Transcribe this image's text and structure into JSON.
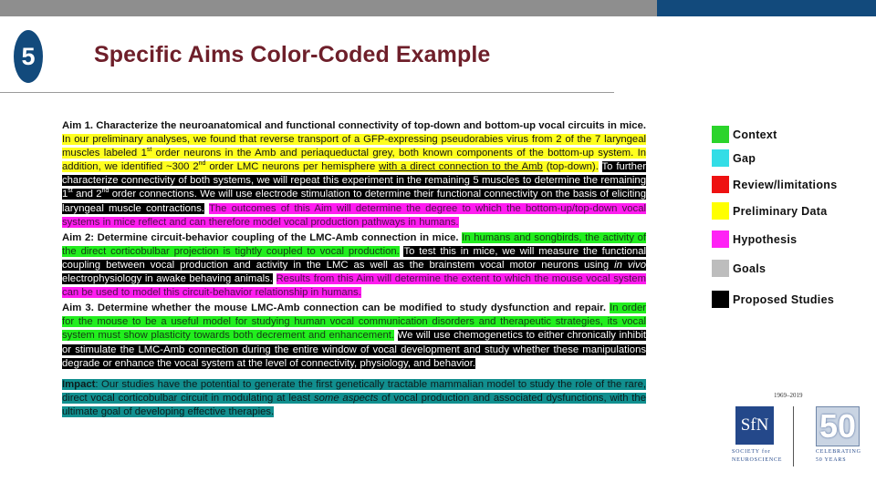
{
  "header": {
    "slide_number": "5",
    "title": "Specific Aims Color-Coded Example"
  },
  "document": {
    "aim1": {
      "heading": "Aim 1. Characterize the neuroanatomical and functional connectivity of top-down and bottom-up vocal circuits in mice.",
      "preliminary_a": "In our preliminary analyses, we found that reverse transport of a GFP-expressing pseudorabies virus from 2 of the 7 laryngeal muscles labeled 1",
      "sup1": "st",
      "preliminary_b": " order neurons in the Amb and periaqueductal grey, both known components of the bottom-up system. In addition, we identified ~300 2",
      "sup2": "nd",
      "preliminary_c": " order LMC neurons per hemisphere ",
      "preliminary_underlined": "with a direct connection to the Amb",
      "preliminary_d": " (top-down).",
      "proposed_a": "To further characterize connectivity of both systems, we will repeat this experiment in the remaining 5 muscles to determine the remaining 1",
      "sup3": "st",
      "proposed_b": " and 2",
      "sup4": "nd",
      "proposed_c": " order connections. We will use electrode stimulation to determine their functional connectivity on the basis of eliciting laryngeal muscle contractions.",
      "hypothesis": "The outcomes of this Aim will determine the degree to which the bottom-up/top-down vocal systems in mice reflect and can therefore model vocal production pathways in humans."
    },
    "aim2": {
      "heading": "Aim 2: Determine circuit-behavior coupling of the LMC-Amb connection in mice.",
      "context": "In humans and songbirds, the activity of the direct corticobulbar projection is tightly coupled to vocal production.",
      "proposed_a": "To test this in mice, we will measure the functional coupling between vocal production and activity in the LMC as well as the brainstem vocal motor neurons using ",
      "proposed_italic": "in vivo",
      "proposed_b": " electrophysiology in awake behaving animals.",
      "hypothesis": "Results from this Aim will determine the extent to which the mouse vocal system can be used to model this circuit-behavior relationship in humans."
    },
    "aim3": {
      "heading": "Aim 3. Determine whether the mouse LMC-Amb connection can be modified to study dysfunction and repair.",
      "context": "In order for the mouse to be a useful model for studying human vocal communication disorders and therapeutic strategies, its vocal system must show plasticity towards both decrement and enhancement.",
      "proposed": "We will use chemogenetics to either chronically inhibit or stimulate the LMC-Amb connection during the entire window of vocal development and study whether these manipulations degrade or enhance the vocal system at the level of connectivity, physiology, and behavior."
    },
    "impact": {
      "label": "Impact",
      "text_a": ": Our studies have the potential to generate the first genetically tractable mammalian model to study the role of the rare, direct vocal corticobulbar circuit in modulating at least ",
      "text_italic": "some aspects",
      "text_b": " of vocal production and associated dysfunctions, with the ultimate goal of developing effective therapies."
    }
  },
  "legend": [
    {
      "label": "Context",
      "color": "#2bd42b"
    },
    {
      "label": "Gap",
      "color": "#33dde6"
    },
    {
      "label": "Review/limitations",
      "color": "#ee1111"
    },
    {
      "label": "Preliminary Data",
      "color": "#ffff00"
    },
    {
      "label": "Hypothesis",
      "color": "#ff22f5"
    },
    {
      "label": "Goals",
      "color": "#bdbdbd"
    },
    {
      "label": "Proposed Studies",
      "color": "#000000"
    }
  ],
  "logo": {
    "years": "1969–2019",
    "sfn_mark": "SfN",
    "sfn_line1": "SOCIETY for",
    "sfn_line2": "NEUROSCIENCE",
    "anniversary_number": "50",
    "anniversary_line1": "CELEBRATING",
    "anniversary_line2": "50 YEARS"
  }
}
